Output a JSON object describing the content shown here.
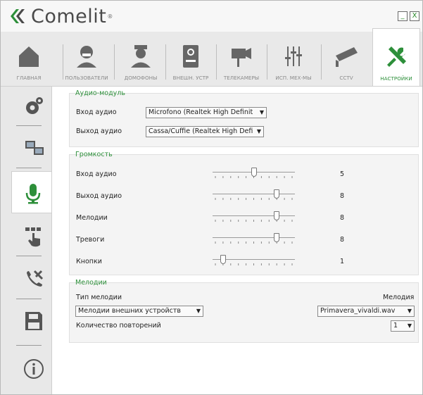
{
  "app": {
    "brand": "Comelit",
    "registered": "®"
  },
  "window": {
    "minimize": "_",
    "close": "X"
  },
  "tabs": [
    {
      "label": "ГЛАВНАЯ",
      "icon": "home-icon"
    },
    {
      "label": "ПОЛЬЗОВАТЕЛИ",
      "icon": "user-icon"
    },
    {
      "label": "ДОМОФОНЫ",
      "icon": "doorman-icon"
    },
    {
      "label": "ВНЕШН. УСТР",
      "icon": "door-panel-icon"
    },
    {
      "label": "ТЕЛЕКАМЕРЫ",
      "icon": "camera-icon"
    },
    {
      "label": "ИСП. МЕХ-МЫ",
      "icon": "actuator-icon"
    },
    {
      "label": "CCTV",
      "icon": "cctv-icon"
    },
    {
      "label": "НАСТРОЙКИ",
      "icon": "settings-tools-icon",
      "active": true
    }
  ],
  "sidebar": [
    {
      "icon": "gear-icon"
    },
    {
      "icon": "network-icon"
    },
    {
      "icon": "microphone-icon",
      "active": true
    },
    {
      "icon": "touch-icon"
    },
    {
      "icon": "phone-tools-icon"
    },
    {
      "icon": "save-icon"
    },
    {
      "icon": "info-icon"
    }
  ],
  "audio_module": {
    "title": "Аудио-модуль",
    "input_label": "Вход аудио",
    "input_value": "Microfono (Realtek High Definit",
    "output_label": "Выход аудио",
    "output_value": "Cassa/Cuffie (Realtek High Defi"
  },
  "volume": {
    "title": "Громкость",
    "rows": [
      {
        "label": "Вход аудио",
        "value": "5",
        "level": 5
      },
      {
        "label": "Выход аудио",
        "value": "8",
        "level": 8
      },
      {
        "label": "Мелодии",
        "value": "8",
        "level": 8
      },
      {
        "label": "Тревоги",
        "value": "8",
        "level": 8
      },
      {
        "label": "Кнопки",
        "value": "1",
        "level": 1
      }
    ],
    "max": 10
  },
  "melodies": {
    "title": "Мелодии",
    "type_label": "Тип мелодии",
    "type_value": "Мелодии внешних устройств",
    "melody_label": "Мелодия",
    "melody_value": "Primavera_vivaldi.wav",
    "repeat_label": "Количество повторений",
    "repeat_value": "1"
  },
  "colors": {
    "accent": "#2d8f3a",
    "icon": "#5a5a5a"
  }
}
